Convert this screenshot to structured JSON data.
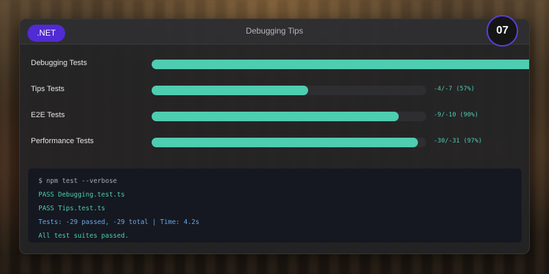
{
  "card": {
    "tag": ".NET",
    "title": "Debugging Tips",
    "number": "07"
  },
  "rows": [
    {
      "label": "Debugging Tests",
      "value": "",
      "progress": 1.0
    },
    {
      "label": "Tips Tests",
      "value": "-4/-7 (57%)",
      "progress": 0.57
    },
    {
      "label": "E2E Tests",
      "value": "-9/-10 (90%)",
      "progress": 0.9
    },
    {
      "label": "Performance Tests",
      "value": "-30/-31 (97%)",
      "progress": 0.97
    }
  ],
  "terminal": {
    "command": "$ npm test --verbose",
    "lines": [
      "PASS Debugging.test.ts",
      "PASS Tips.test.ts"
    ],
    "summary": "Tests: -29 passed, -29 total | Time: 4.2s",
    "result": "All test suites passed."
  },
  "colors": {
    "accent": "#512bd4",
    "progress": "#4ecdb0",
    "summary": "#6aa8e8"
  }
}
